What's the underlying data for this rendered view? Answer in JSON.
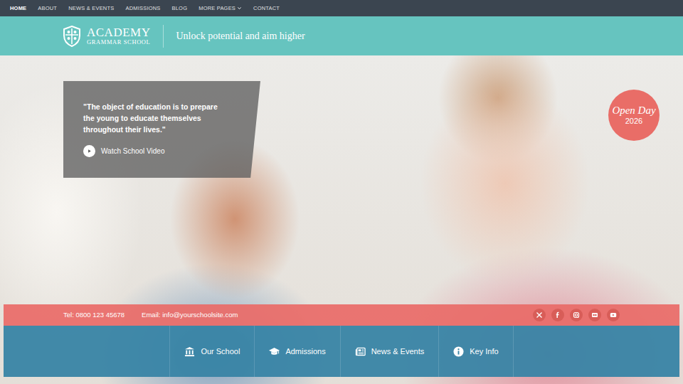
{
  "nav": {
    "items": [
      {
        "label": "HOME",
        "selected": true,
        "has_menu": false
      },
      {
        "label": "ABOUT",
        "selected": false,
        "has_menu": false
      },
      {
        "label": "NEWS & EVENTS",
        "selected": false,
        "has_menu": false
      },
      {
        "label": "ADMISSIONS",
        "selected": false,
        "has_menu": false
      },
      {
        "label": "BLOG",
        "selected": false,
        "has_menu": false
      },
      {
        "label": "MORE PAGES",
        "selected": false,
        "has_menu": true
      },
      {
        "label": "CONTACT",
        "selected": false,
        "has_menu": false
      }
    ]
  },
  "logo": {
    "title": "ACADEMY",
    "subtitle": "GRAMMAR SCHOOL"
  },
  "tagline": "Unlock potential and aim higher",
  "hero": {
    "quote": "\"The object of education is to prepare the young to educate themselves throughout their lives.\"",
    "video_link": "Watch School Video"
  },
  "badge": {
    "title": "Open Day",
    "year": "2026"
  },
  "contact": {
    "phone": "Tel: 0800 123 45678",
    "email": "Email: info@yourschoolsite.com"
  },
  "quick_links": [
    {
      "label": "Our School"
    },
    {
      "label": "Admissions"
    },
    {
      "label": "News & Events"
    },
    {
      "label": "Key Info"
    }
  ]
}
